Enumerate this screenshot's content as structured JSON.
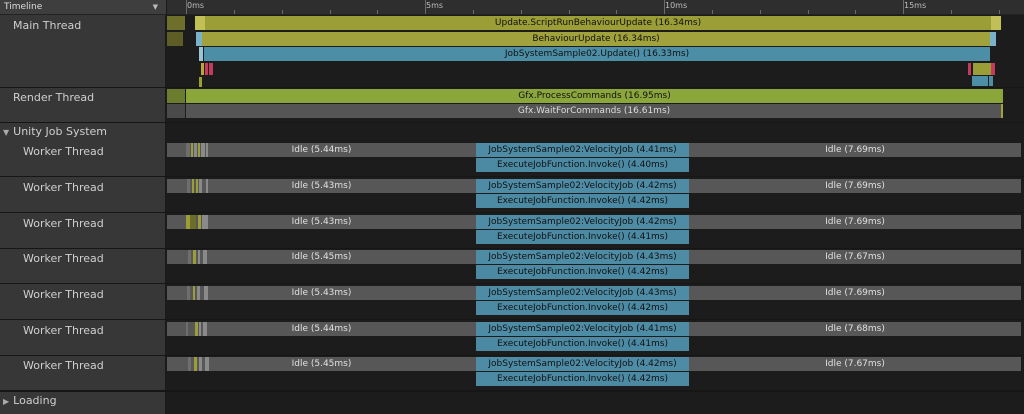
{
  "header": {
    "title": "Timeline"
  },
  "ruler": {
    "labels": [
      "0ms",
      "5ms",
      "10ms",
      "15ms"
    ]
  },
  "threads": {
    "main": {
      "label": "Main Thread",
      "bars": [
        "Update.ScriptRunBehaviourUpdate (16.34ms)",
        "BehaviourUpdate (16.34ms)",
        "JobSystemSample02.Update() (16.33ms)"
      ]
    },
    "render": {
      "label": "Render Thread",
      "bars": [
        "Gfx.ProcessCommands (16.95ms)",
        "Gfx.WaitForCommands (16.61ms)"
      ]
    }
  },
  "job_system": {
    "label": "Unity Job System",
    "workers": [
      {
        "label": "Worker Thread",
        "idle1": "Idle (5.44ms)",
        "job": "JobSystemSample02:VelocityJob (4.41ms)",
        "invoke": "ExecuteJobFunction.Invoke() (4.40ms)",
        "idle2": "Idle (7.69ms)"
      },
      {
        "label": "Worker Thread",
        "idle1": "Idle (5.43ms)",
        "job": "JobSystemSample02:VelocityJob (4.42ms)",
        "invoke": "ExecuteJobFunction.Invoke() (4.42ms)",
        "idle2": "Idle (7.69ms)"
      },
      {
        "label": "Worker Thread",
        "idle1": "Idle (5.43ms)",
        "job": "JobSystemSample02:VelocityJob (4.42ms)",
        "invoke": "ExecuteJobFunction.Invoke() (4.41ms)",
        "idle2": "Idle (7.69ms)"
      },
      {
        "label": "Worker Thread",
        "idle1": "Idle (5.45ms)",
        "job": "JobSystemSample02:VelocityJob (4.43ms)",
        "invoke": "ExecuteJobFunction.Invoke() (4.42ms)",
        "idle2": "Idle (7.67ms)"
      },
      {
        "label": "Worker Thread",
        "idle1": "Idle (5.43ms)",
        "job": "JobSystemSample02:VelocityJob (4.43ms)",
        "invoke": "ExecuteJobFunction.Invoke() (4.42ms)",
        "idle2": "Idle (7.69ms)"
      },
      {
        "label": "Worker Thread",
        "idle1": "Idle (5.44ms)",
        "job": "JobSystemSample02:VelocityJob (4.41ms)",
        "invoke": "ExecuteJobFunction.Invoke() (4.41ms)",
        "idle2": "Idle (7.68ms)"
      },
      {
        "label": "Worker Thread",
        "idle1": "Idle (5.45ms)",
        "job": "JobSystemSample02:VelocityJob (4.42ms)",
        "invoke": "ExecuteJobFunction.Invoke() (4.42ms)",
        "idle2": "Idle (7.67ms)"
      }
    ]
  },
  "loading": {
    "label": "Loading"
  },
  "colors": {
    "script_update": "#9b9d36",
    "behaviour": "#a1a23c",
    "job": "#4e8ca6",
    "gfx": "#8ba63b",
    "idle": "#575757"
  }
}
